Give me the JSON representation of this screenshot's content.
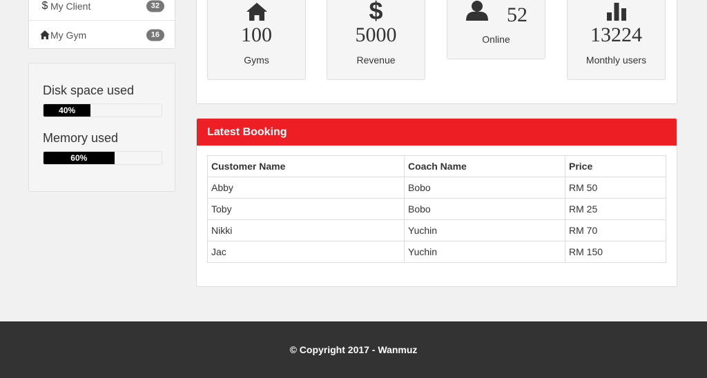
{
  "sidebar": {
    "items": [
      {
        "label": "My Client",
        "badge": "32",
        "icon": "dollar-icon"
      },
      {
        "label": "My Gym",
        "badge": "16",
        "icon": "home-icon"
      }
    ]
  },
  "system": {
    "disk_label": "Disk space used",
    "disk_value_text": "40%",
    "disk_percent": 40,
    "memory_label": "Memory used",
    "memory_value_text": "60%",
    "memory_percent": 60
  },
  "stats": {
    "gyms": {
      "value": "100",
      "label": "Gyms",
      "icon": "home-icon"
    },
    "revenue": {
      "value": "5000",
      "label": "Revenue",
      "icon": "dollar-icon"
    },
    "online": {
      "value": "52",
      "label": "Online",
      "icon": "user-icon"
    },
    "monthly": {
      "value": "13224",
      "label": "Monthly users",
      "icon": "bar-chart-icon"
    }
  },
  "booking": {
    "title": "Latest Booking",
    "columns": [
      "Customer Name",
      "Coach Name",
      "Price"
    ],
    "rows": [
      [
        "Abby",
        "Bobo",
        "RM 50"
      ],
      [
        "Toby",
        "Bobo",
        "RM 25"
      ],
      [
        "Nikki",
        "Yuchin",
        "RM 70"
      ],
      [
        "Jac",
        "Yuchin",
        "RM 150"
      ]
    ]
  },
  "footer": {
    "text": "© Copyright 2017 - Wanmuz"
  },
  "colors": {
    "accent": "#ee1f24",
    "footer_bg": "#333333",
    "progress": "#000000"
  }
}
